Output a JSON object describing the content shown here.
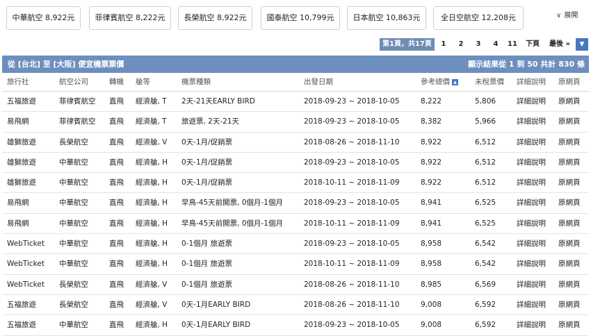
{
  "filters": {
    "chips": [
      "中華航空 8,922元",
      "菲律賓航空 8,222元",
      "長榮航空 8,922元",
      "國泰航空 10,799元",
      "日本航空 10,863元",
      "全日空航空 12,208元"
    ],
    "expand_label": "展開"
  },
  "pager": {
    "current": "第1頁，共17頁",
    "pages": [
      "1",
      "2",
      "3",
      "4",
      "11"
    ],
    "next": "下頁",
    "last": "最後 »",
    "dropdown": "▼"
  },
  "results": {
    "title": "從 [台北] 至 [大阪] 便宜機票票價",
    "count": "顯示結果從 1 到 50 共計 830 條"
  },
  "table": {
    "headers": [
      "旅行社",
      "航空公司",
      "轉機",
      "艙等",
      "機票種類",
      "出發日期",
      "參考總價",
      "未稅票價",
      "詳細說明",
      "原網頁"
    ],
    "rows": [
      [
        "五福旅遊",
        "菲律賓航空",
        "直飛",
        "經濟艙, T",
        "2天-21天EARLY BIRD",
        "2018-09-23 ~ 2018-10-05",
        "8,222",
        "5,806",
        "詳細說明",
        "原網頁"
      ],
      [
        "易飛網",
        "菲律賓航空",
        "直飛",
        "經濟艙, T",
        "旅遊票, 2天-21天",
        "2018-09-23 ~ 2018-10-05",
        "8,382",
        "5,966",
        "詳細說明",
        "原網頁"
      ],
      [
        "雄獅旅遊",
        "長榮航空",
        "直飛",
        "經濟艙, V",
        "0天-1月/促銷票",
        "2018-08-26 ~ 2018-11-10",
        "8,922",
        "6,512",
        "詳細說明",
        "原網頁"
      ],
      [
        "雄獅旅遊",
        "中華航空",
        "直飛",
        "經濟艙, H",
        "0天-1月/促銷票",
        "2018-09-23 ~ 2018-10-05",
        "8,922",
        "6,512",
        "詳細說明",
        "原網頁"
      ],
      [
        "雄獅旅遊",
        "中華航空",
        "直飛",
        "經濟艙, H",
        "0天-1月/促銷票",
        "2018-10-11 ~ 2018-11-09",
        "8,922",
        "6,512",
        "詳細說明",
        "原網頁"
      ],
      [
        "易飛網",
        "中華航空",
        "直飛",
        "經濟艙, H",
        "早鳥-45天前開票, 0個月-1個月",
        "2018-09-23 ~ 2018-10-05",
        "8,941",
        "6,525",
        "詳細說明",
        "原網頁"
      ],
      [
        "易飛網",
        "中華航空",
        "直飛",
        "經濟艙, H",
        "早鳥-45天前開票, 0個月-1個月",
        "2018-10-11 ~ 2018-11-09",
        "8,941",
        "6,525",
        "詳細說明",
        "原網頁"
      ],
      [
        "WebTicket",
        "中華航空",
        "直飛",
        "經濟艙, H",
        "0-1個月 旅遊票",
        "2018-09-23 ~ 2018-10-05",
        "8,958",
        "6,542",
        "詳細說明",
        "原網頁"
      ],
      [
        "WebTicket",
        "中華航空",
        "直飛",
        "經濟艙, H",
        "0-1個月 旅遊票",
        "2018-10-11 ~ 2018-11-09",
        "8,958",
        "6,542",
        "詳細說明",
        "原網頁"
      ],
      [
        "WebTicket",
        "長榮航空",
        "直飛",
        "經濟艙, V",
        "0-1個月 旅遊票",
        "2018-08-26 ~ 2018-11-10",
        "8,985",
        "6,569",
        "詳細說明",
        "原網頁"
      ],
      [
        "五福旅遊",
        "長榮航空",
        "直飛",
        "經濟艙, V",
        "0天-1月EARLY BIRD",
        "2018-08-26 ~ 2018-11-10",
        "9,008",
        "6,592",
        "詳細說明",
        "原網頁"
      ],
      [
        "五福旅遊",
        "中華航空",
        "直飛",
        "經濟艙, H",
        "0天-1月EARLY BIRD",
        "2018-09-23 ~ 2018-10-05",
        "9,008",
        "6,592",
        "詳細說明",
        "原網頁"
      ]
    ]
  }
}
